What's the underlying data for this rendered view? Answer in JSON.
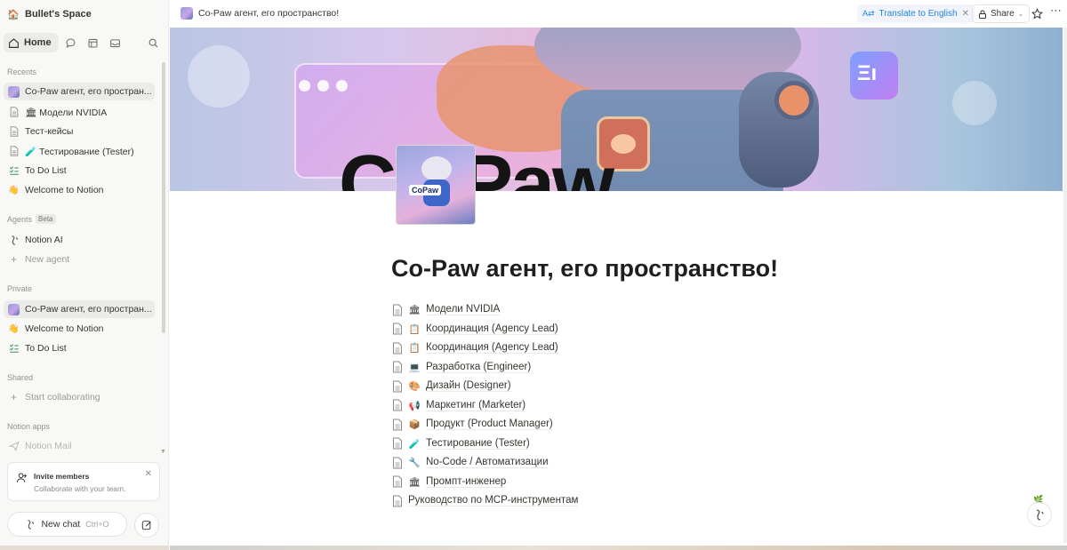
{
  "sidebar": {
    "workspace_name": "Bullet's Space",
    "home_label": "Home",
    "recents_heading": "Recents",
    "recents": [
      {
        "label": "Co-Paw агент, его простран...",
        "icon": "cover-thumb"
      },
      {
        "label": "🏛 Модели NVIDIA",
        "icon": "page-icon"
      },
      {
        "label": "Тест-кейсы",
        "icon": "page-icon"
      },
      {
        "label": "🧪 Тестирование (Tester)",
        "icon": "page-icon"
      },
      {
        "label": "To Do List",
        "icon": "checklist-icon"
      },
      {
        "label": "Welcome to Notion",
        "icon": "wave-icon"
      }
    ],
    "agents_heading": "Agents",
    "agents_badge": "Beta",
    "agents": [
      {
        "label": "Notion AI"
      },
      {
        "label": "New agent"
      }
    ],
    "private_heading": "Private",
    "private": [
      {
        "label": "Co-Paw агент, его простран..."
      },
      {
        "label": "Welcome to Notion"
      },
      {
        "label": "To Do List"
      }
    ],
    "shared_heading": "Shared",
    "shared_action": "Start collaborating",
    "apps_heading": "Notion apps",
    "apps": [
      {
        "label": "Notion Mail"
      }
    ],
    "invite_title": "Invite members",
    "invite_subtitle": "Collaborate with your team.",
    "new_chat_label": "New chat",
    "new_chat_shortcut": "Ctrl+O"
  },
  "topbar": {
    "breadcrumb": "Co-Paw агент, его пространство!",
    "translate_label": "Translate to English",
    "share_label": "Share"
  },
  "page": {
    "title": "Co-Paw агент, его пространство!",
    "subpages": [
      {
        "emoji": "🏛",
        "label": "Модели NVIDIA"
      },
      {
        "emoji": "📋",
        "label": "Координация (Agency Lead)"
      },
      {
        "emoji": "📋",
        "label": "Координация (Agency Lead)"
      },
      {
        "emoji": "💻",
        "label": "Разработка (Engineer)"
      },
      {
        "emoji": "🎨",
        "label": "Дизайн (Designer)"
      },
      {
        "emoji": "📢",
        "label": "Маркетинг (Marketer)"
      },
      {
        "emoji": "📦",
        "label": "Продукт (Product Manager)"
      },
      {
        "emoji": "🧪",
        "label": "Тестирование (Tester)"
      },
      {
        "emoji": "🔧",
        "label": "No-Code / Автоматизации"
      },
      {
        "emoji": "🏛",
        "label": "Промпт-инженер"
      },
      {
        "emoji": "",
        "label": "Руководство по MCP-инструментам"
      }
    ],
    "cover_icon_text": "CoPaw"
  },
  "colors": {
    "sidebar_bg": "#f8f8f7",
    "accent_blue": "#2383e2",
    "text": "#37352f"
  }
}
